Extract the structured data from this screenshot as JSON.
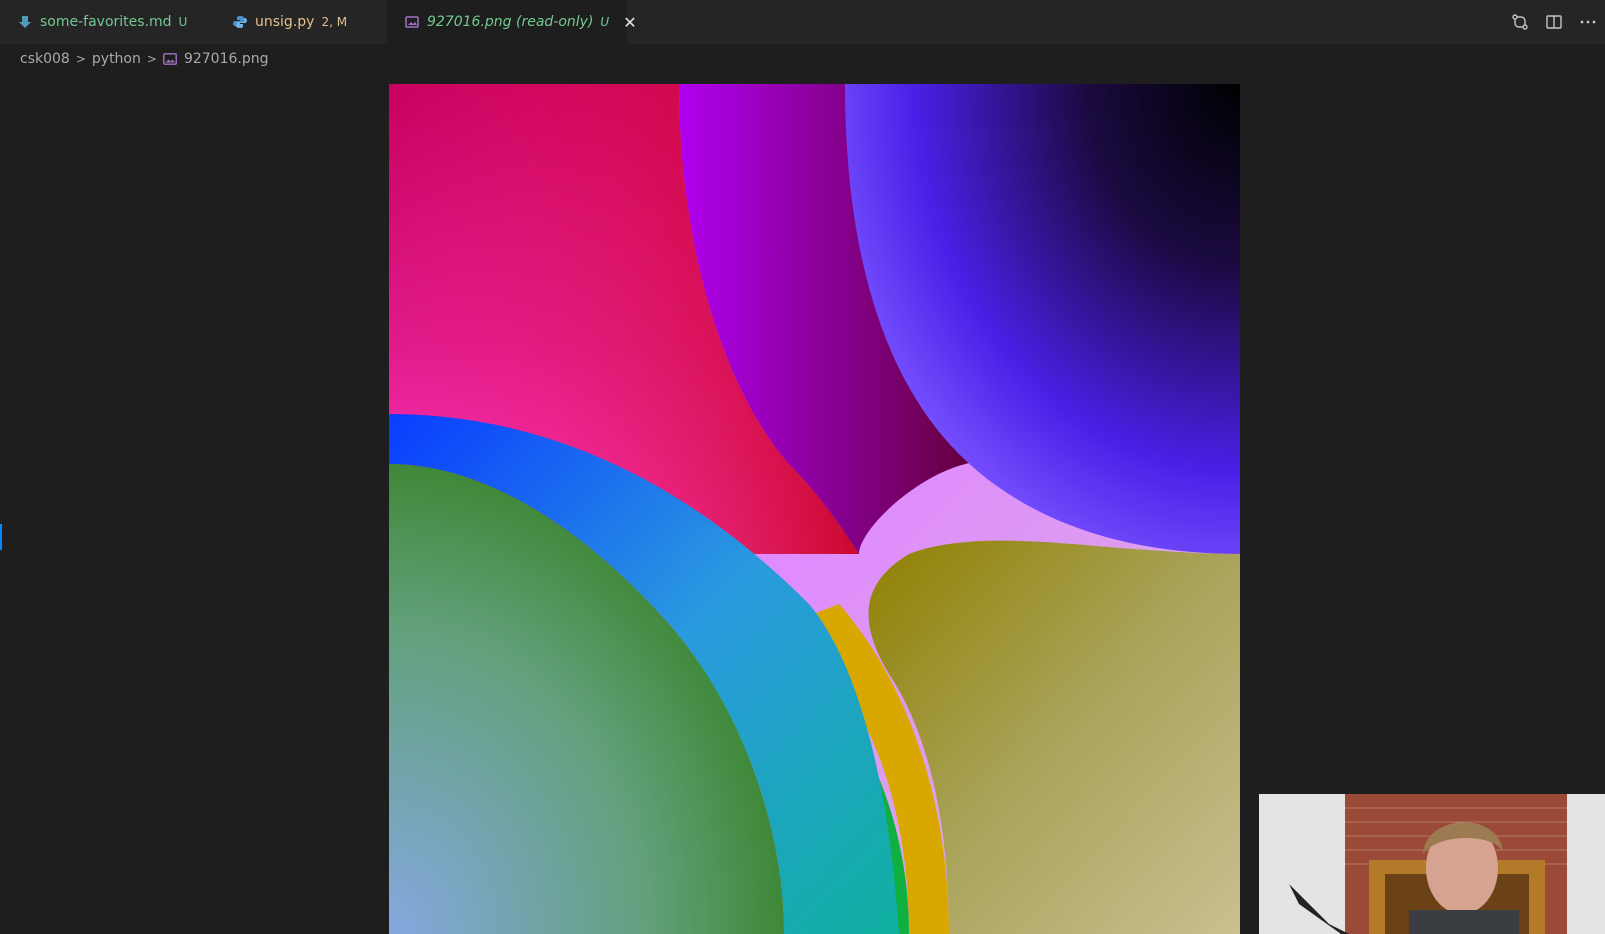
{
  "tabs": [
    {
      "label": "some-favorites.md",
      "badge": "U",
      "icon": "markdown-file-icon"
    },
    {
      "label": "unsig.py",
      "badge": "2, M",
      "icon": "python-file-icon"
    },
    {
      "label": "927016.png (read-only)",
      "badge": "U",
      "icon": "image-file-icon",
      "active": true
    }
  ],
  "breadcrumb": {
    "items": [
      "csk008",
      "python",
      "927016.png"
    ]
  },
  "actions": [
    "compare-changes-icon",
    "split-editor-icon",
    "more-actions-icon"
  ],
  "colors": {
    "editor_bg": "#1e1e1e",
    "tabbar_bg": "#252526",
    "untracked": "#73c991",
    "modified": "#e2c08d",
    "accent": "#0a84ff"
  }
}
